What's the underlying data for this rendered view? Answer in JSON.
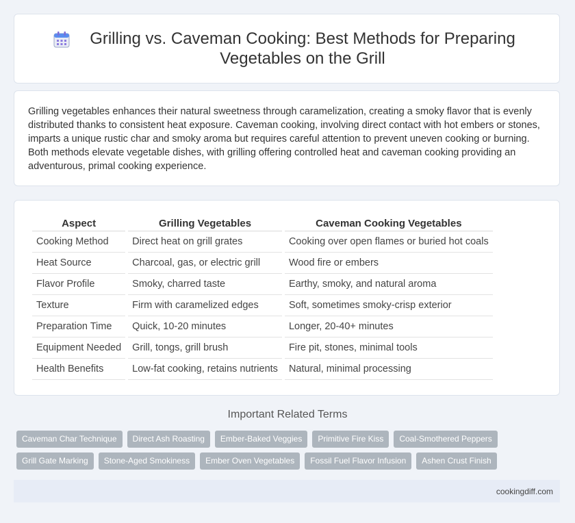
{
  "header": {
    "title": "Grilling vs. Caveman Cooking: Best Methods for Preparing Vegetables on the Grill",
    "icon": "calendar-icon"
  },
  "intro": {
    "text": "Grilling vegetables enhances their natural sweetness through caramelization, creating a smoky flavor that is evenly distributed thanks to consistent heat exposure. Caveman cooking, involving direct contact with hot embers or stones, imparts a unique rustic char and smoky aroma but requires careful attention to prevent uneven cooking or burning. Both methods elevate vegetable dishes, with grilling offering controlled heat and caveman cooking providing an adventurous, primal cooking experience."
  },
  "table": {
    "headers": [
      "Aspect",
      "Grilling Vegetables",
      "Caveman Cooking Vegetables"
    ],
    "rows": [
      [
        "Cooking Method",
        "Direct heat on grill grates",
        "Cooking over open flames or buried hot coals"
      ],
      [
        "Heat Source",
        "Charcoal, gas, or electric grill",
        "Wood fire or embers"
      ],
      [
        "Flavor Profile",
        "Smoky, charred taste",
        "Earthy, smoky, and natural aroma"
      ],
      [
        "Texture",
        "Firm with caramelized edges",
        "Soft, sometimes smoky-crisp exterior"
      ],
      [
        "Preparation Time",
        "Quick, 10-20 minutes",
        "Longer, 20-40+ minutes"
      ],
      [
        "Equipment Needed",
        "Grill, tongs, grill brush",
        "Fire pit, stones, minimal tools"
      ],
      [
        "Health Benefits",
        "Low-fat cooking, retains nutrients",
        "Natural, minimal processing"
      ]
    ]
  },
  "related": {
    "title": "Important Related Terms",
    "row1": [
      "Caveman Char Technique",
      "Direct Ash Roasting",
      "Ember-Baked Veggies",
      "Primitive Fire Kiss",
      "Coal-Smothered Peppers"
    ],
    "row2": [
      "Grill Gate Marking",
      "Stone-Aged Smokiness",
      "Ember Oven Vegetables",
      "Fossil Fuel Flavor Infusion",
      "Ashen Crust Finish"
    ]
  },
  "footer": {
    "site": "cookingdiff.com"
  },
  "colors": {
    "background": "#f0f3f8",
    "tag": "#adb5bd",
    "footer": "#e7ecf6",
    "icon_accent": "#5b8def"
  }
}
